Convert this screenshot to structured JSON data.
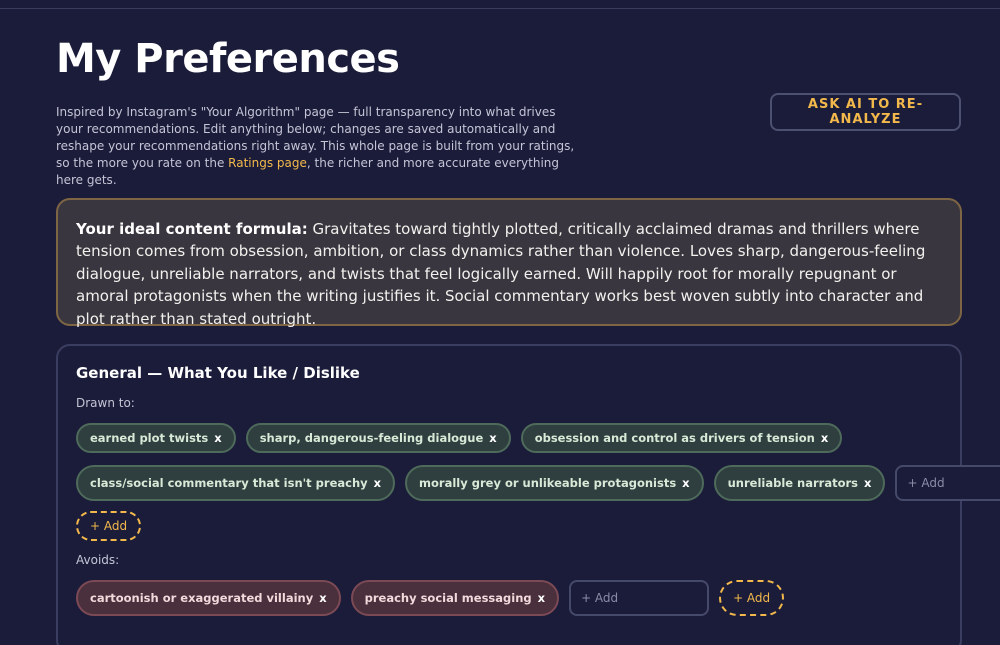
{
  "page": {
    "title": "My Preferences",
    "intro_text": "Inspired by Instagram's \"Your Algorithm\" page — full transparency into what drives your recommendations. Edit anything below; changes are saved automatically and reshape your recommendations right away. This whole page is built from your ratings, so the more you rate on the ",
    "intro_link": "Ratings page",
    "intro_tail": ", the richer and more accurate everything here gets.",
    "ask_ai_label": "ASK AI TO RE-ANALYZE"
  },
  "formula": {
    "label": "Your ideal content formula:",
    "text": " Gravitates toward tightly plotted, critically acclaimed dramas and thrillers where tension comes from obsession, ambition, or class dynamics rather than violence. Loves sharp, dangerous-feeling dialogue, unreliable narrators, and twists that feel logically earned. Will happily root for morally repugnant or amoral protagonists when the writing justifies it. Social commentary works best woven subtly into character and plot rather than stated outright."
  },
  "general": {
    "title": "General — What You Like / Dislike",
    "drawn_label": "Drawn to:",
    "drawn_row1": [
      "earned plot twists",
      "sharp, dangerous-feeling dialogue",
      "obsession and control as drivers of tension"
    ],
    "drawn_row2": [
      "class/social commentary that isn't preachy",
      "morally grey or unlikeable protagonists",
      "unreliable narrators"
    ],
    "avoids_label": "Avoids:",
    "avoids": [
      "cartoonish or exaggerated villainy",
      "preachy social messaging"
    ],
    "remove_glyph": "x",
    "add_placeholder": "+ Add",
    "add_button_label": "+ Add"
  },
  "colors": {
    "background": "#1b1c3a",
    "accent": "#f2b84b",
    "like_chip": "#2f3e3f",
    "avoid_chip": "#4a2f3c",
    "formula_bg": "#3a363f"
  }
}
